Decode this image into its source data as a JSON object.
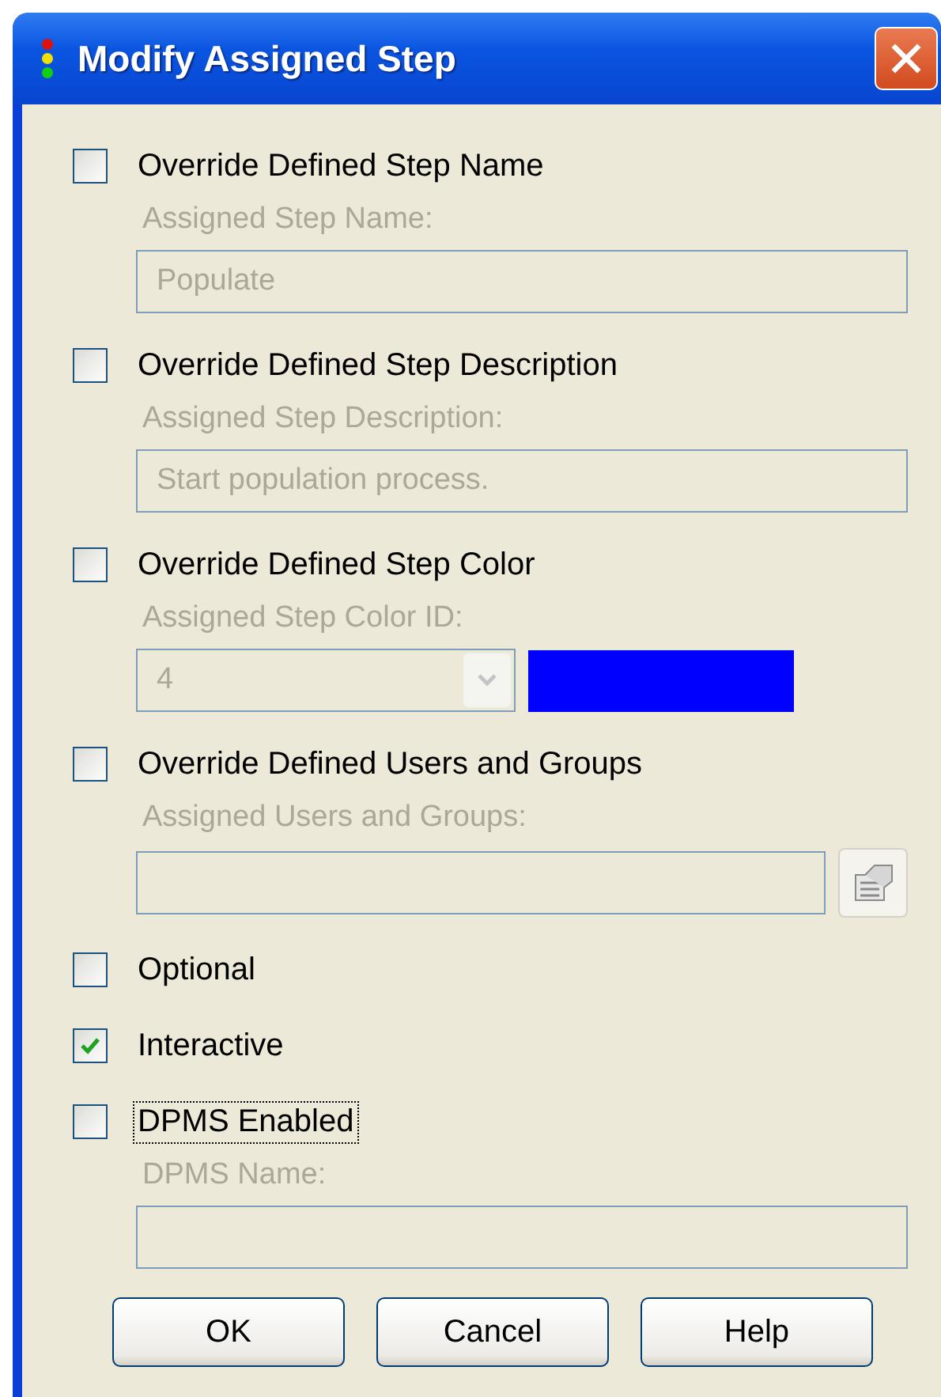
{
  "window": {
    "title": "Modify Assigned Step"
  },
  "options": [
    {
      "label": "Override Defined Step Name",
      "checked": false,
      "focused": false,
      "field": {
        "kind": "text",
        "label": "Assigned Step Name:",
        "value": "Populate",
        "disabled": true
      }
    },
    {
      "label": "Override Defined Step Description",
      "checked": false,
      "focused": false,
      "field": {
        "kind": "text",
        "label": "Assigned Step Description:",
        "value": "Start population process.",
        "disabled": true
      }
    },
    {
      "label": "Override Defined Step Color",
      "checked": false,
      "focused": false,
      "field": {
        "kind": "combo",
        "label": "Assigned Step Color ID:",
        "value": "4",
        "color": "#0000ff",
        "disabled": true
      }
    },
    {
      "label": "Override Defined Users and Groups",
      "checked": false,
      "focused": false,
      "field": {
        "kind": "picker",
        "label": "Assigned Users and Groups:",
        "disabled": true
      }
    },
    {
      "label": "Optional",
      "checked": false,
      "focused": false
    },
    {
      "label": "Interactive",
      "checked": true,
      "focused": false
    },
    {
      "label": "DPMS Enabled",
      "checked": false,
      "focused": true,
      "field": {
        "kind": "text",
        "label": "DPMS Name:",
        "disabled": true
      }
    }
  ],
  "buttons": [
    "OK",
    "Cancel",
    "Help"
  ]
}
